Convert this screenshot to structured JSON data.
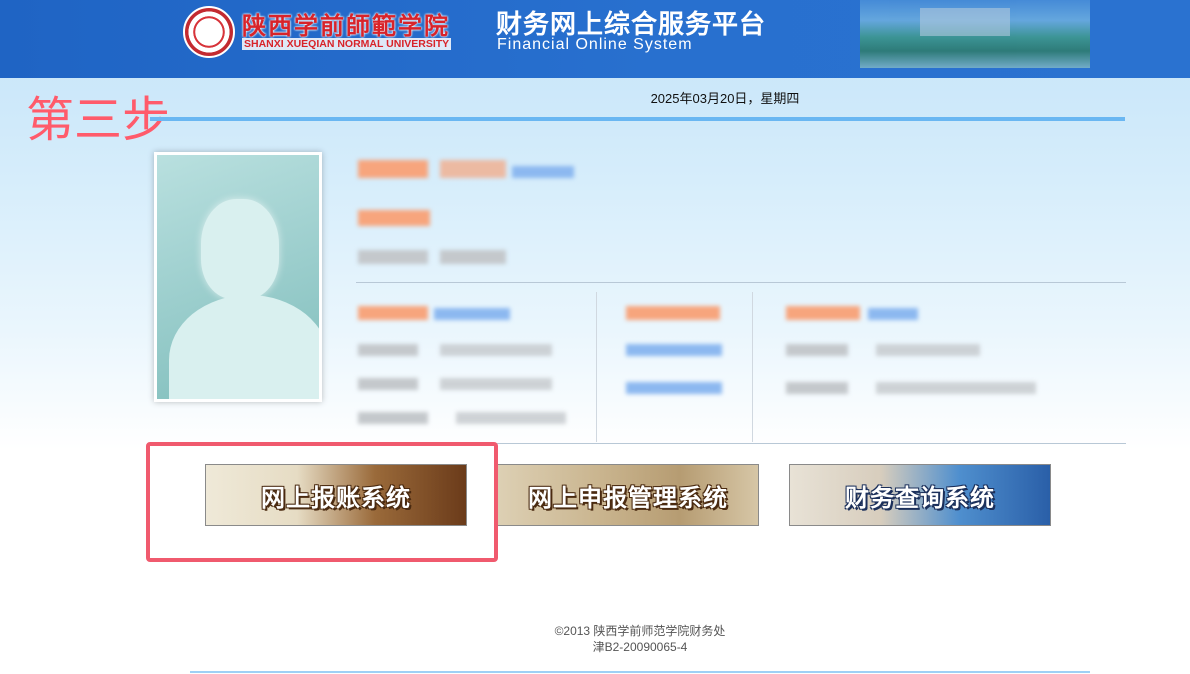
{
  "header": {
    "university_cn": "陕西学前師範学院",
    "university_en": "SHANXI XUEQIAN NORMAL UNIVERSITY",
    "system_title": "财务网上综合服务平台",
    "system_subtitle": "Financial  Online  System"
  },
  "annotation": {
    "step_label": "第三步"
  },
  "date_text": "2025年03月20日，星期四",
  "systems": [
    {
      "label": "网上报账系统"
    },
    {
      "label": "网上申报管理系统"
    },
    {
      "label": "财务查询系统"
    }
  ],
  "footer": {
    "copyright": "©2013 陕西学前师范学院财务处",
    "icp": "津B2-20090065-4"
  }
}
